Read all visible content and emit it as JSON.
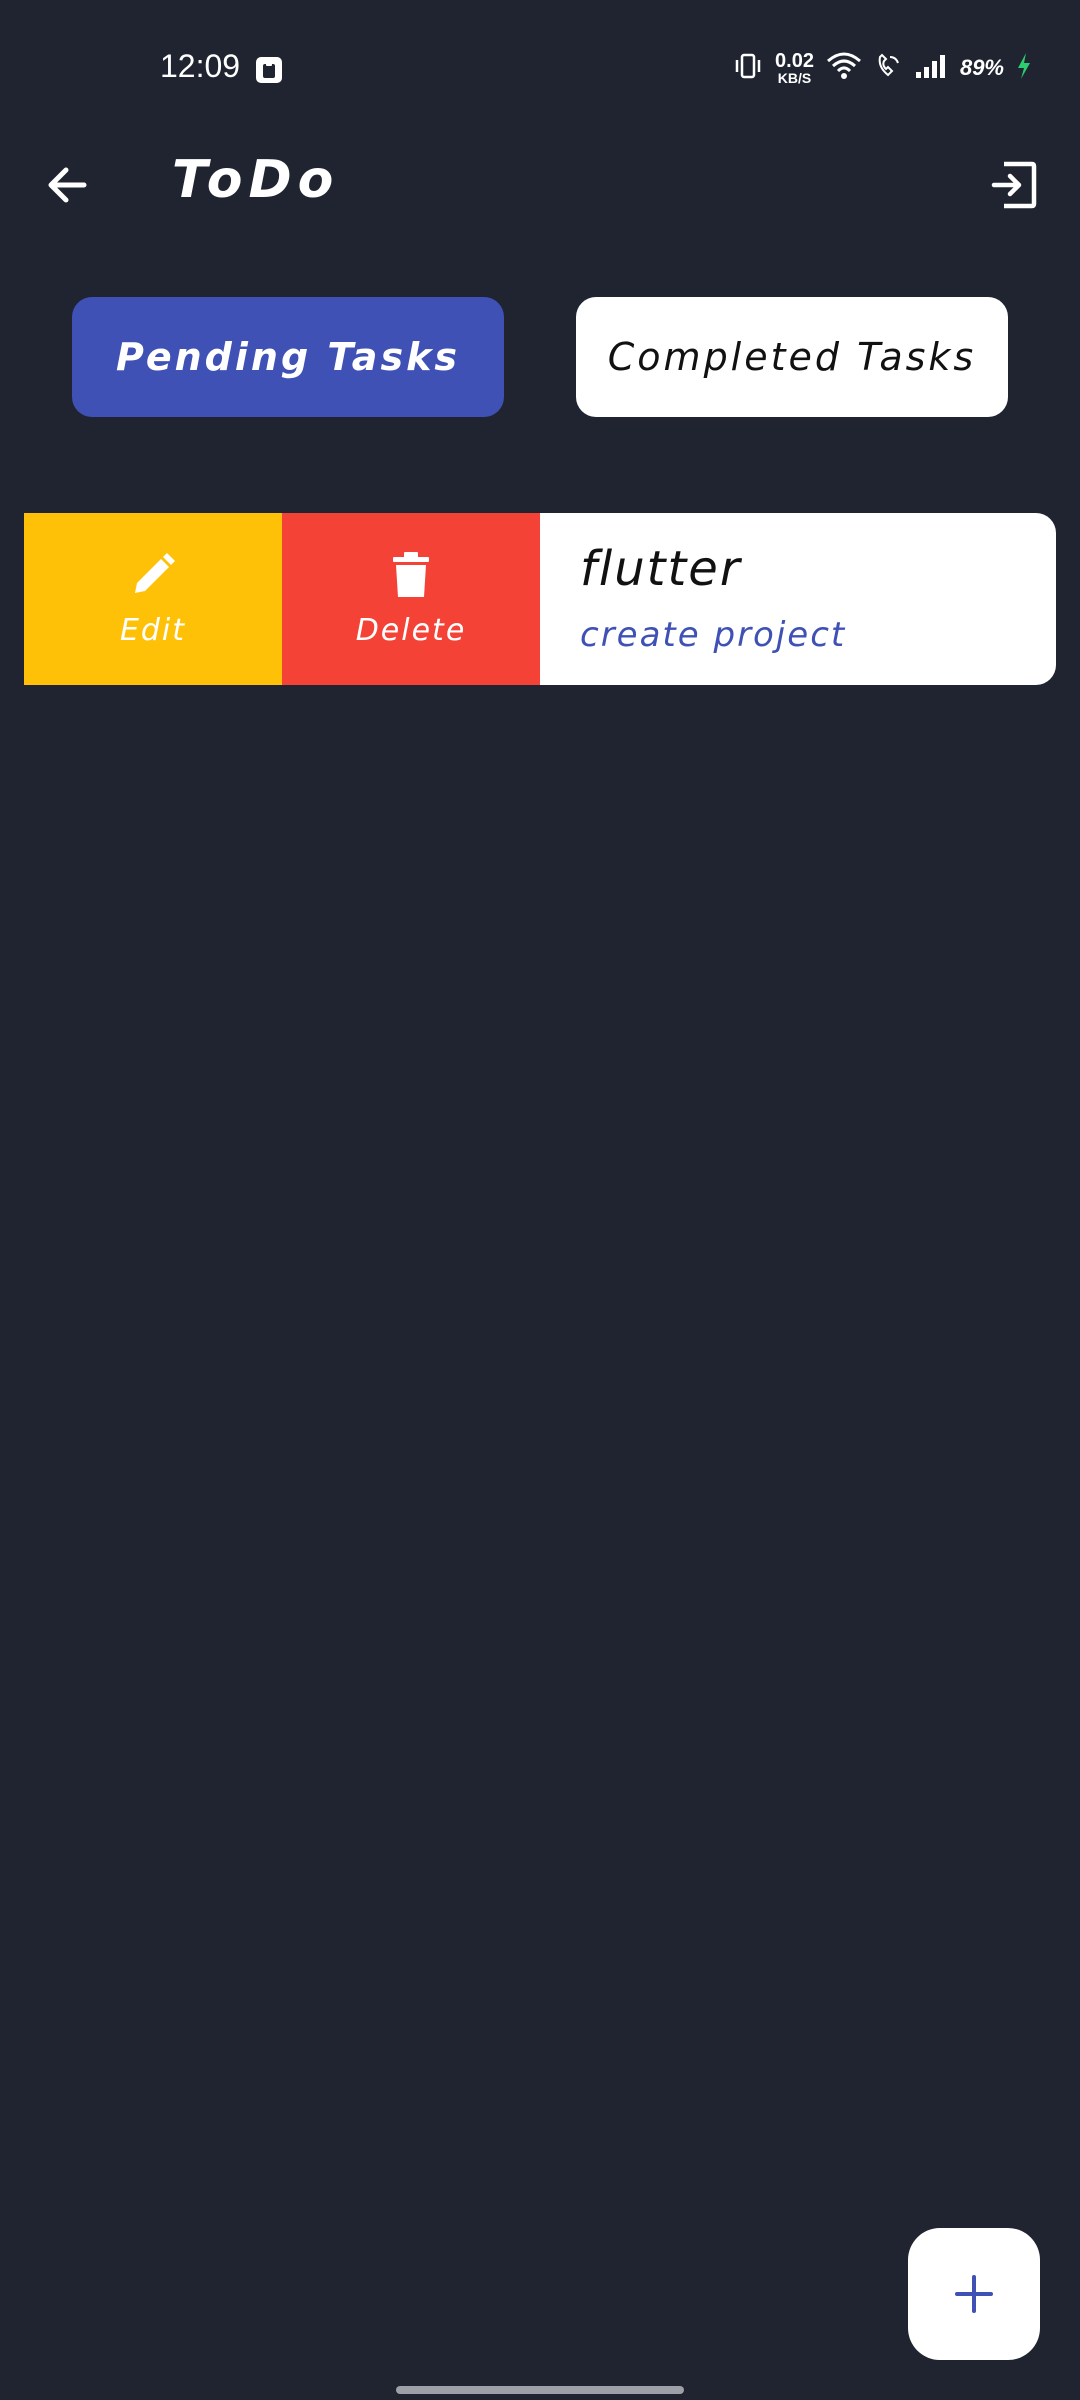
{
  "status_bar": {
    "time": "12:09",
    "net_speed_value": "0.02",
    "net_speed_unit": "KB/S",
    "battery": "89%"
  },
  "app_bar": {
    "title": "ToDo",
    "back_icon": "arrow-left-icon",
    "logout_icon": "exit-icon"
  },
  "tabs": [
    {
      "label": "Pending Tasks",
      "active": true
    },
    {
      "label": "Completed Tasks",
      "active": false
    }
  ],
  "task": {
    "title": "flutter",
    "description": "create project",
    "actions": {
      "edit_label": "Edit",
      "delete_label": "Delete"
    }
  },
  "fab": {
    "icon": "plus-icon"
  },
  "colors": {
    "background": "#1f2430",
    "primary": "#3f51b5",
    "edit": "#ffc107",
    "delete": "#f44336",
    "charging": "#2ecc71"
  }
}
